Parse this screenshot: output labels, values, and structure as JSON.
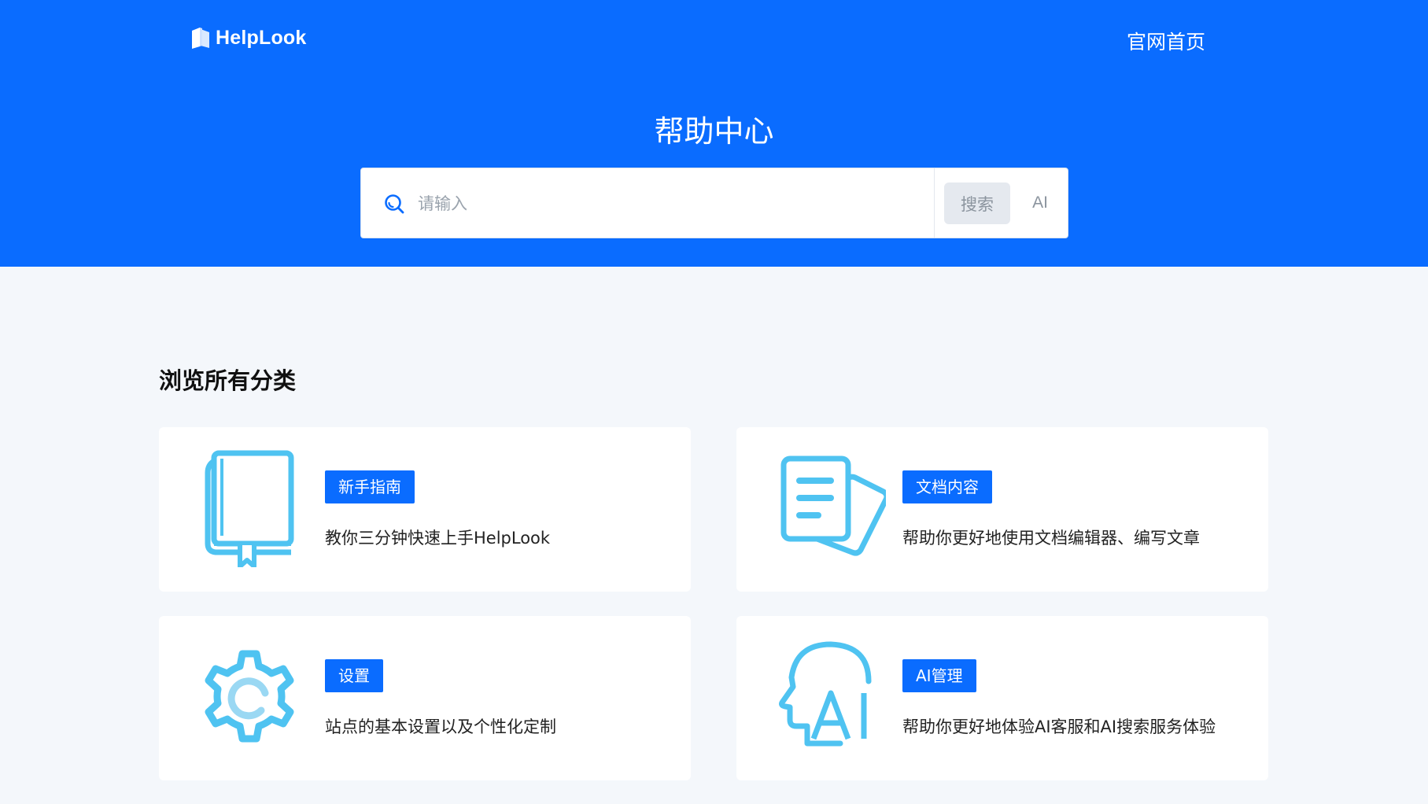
{
  "header": {
    "logo_text": "HelpLook",
    "home_link": "官网首页",
    "title": "帮助中心"
  },
  "search": {
    "placeholder": "请输入",
    "search_button": "搜索",
    "ai_button": "AI"
  },
  "section": {
    "title": "浏览所有分类"
  },
  "categories": [
    {
      "tag": "新手指南",
      "description": "教你三分钟快速上手HelpLook",
      "icon": "book-icon"
    },
    {
      "tag": "文档内容",
      "description": "帮助你更好地使用文档编辑器、编写文章",
      "icon": "document-icon"
    },
    {
      "tag": "设置",
      "description": "站点的基本设置以及个性化定制",
      "icon": "gear-icon"
    },
    {
      "tag": "AI管理",
      "description": "帮助你更好地体验AI客服和AI搜索服务体验",
      "icon": "ai-head-icon"
    }
  ],
  "colors": {
    "brand_blue": "#0a6cff",
    "icon_blue": "#4fc3f1",
    "page_bg": "#f4f7fb"
  }
}
